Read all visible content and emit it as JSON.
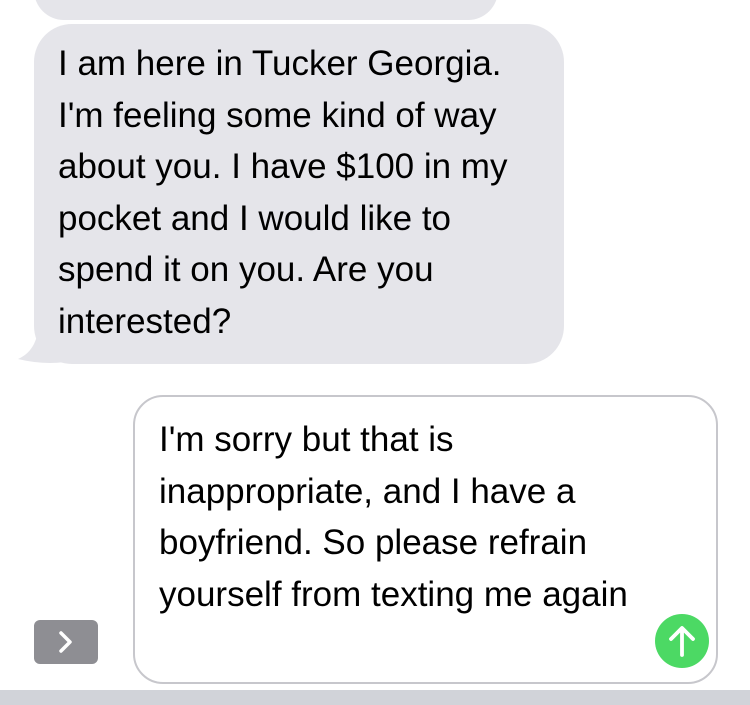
{
  "conversation": {
    "incoming_message": "I am here in Tucker Georgia. I'm feeling some kind of way about you. I have $100 in my pocket and I would like to spend it on you. Are you interested?"
  },
  "composer": {
    "draft_text": "I'm sorry but that is inappropriate, and I have a boyfriend. So please refrain yourself from texting me again",
    "expand_icon": "chevron-right-icon",
    "send_icon": "arrow-up-icon"
  },
  "colors": {
    "incoming_bubble": "#e5e5ea",
    "send_button": "#4cd964",
    "expand_button": "#8e8e93",
    "input_border": "#c7c7cc",
    "keyboard_strip": "#d1d3d9"
  }
}
